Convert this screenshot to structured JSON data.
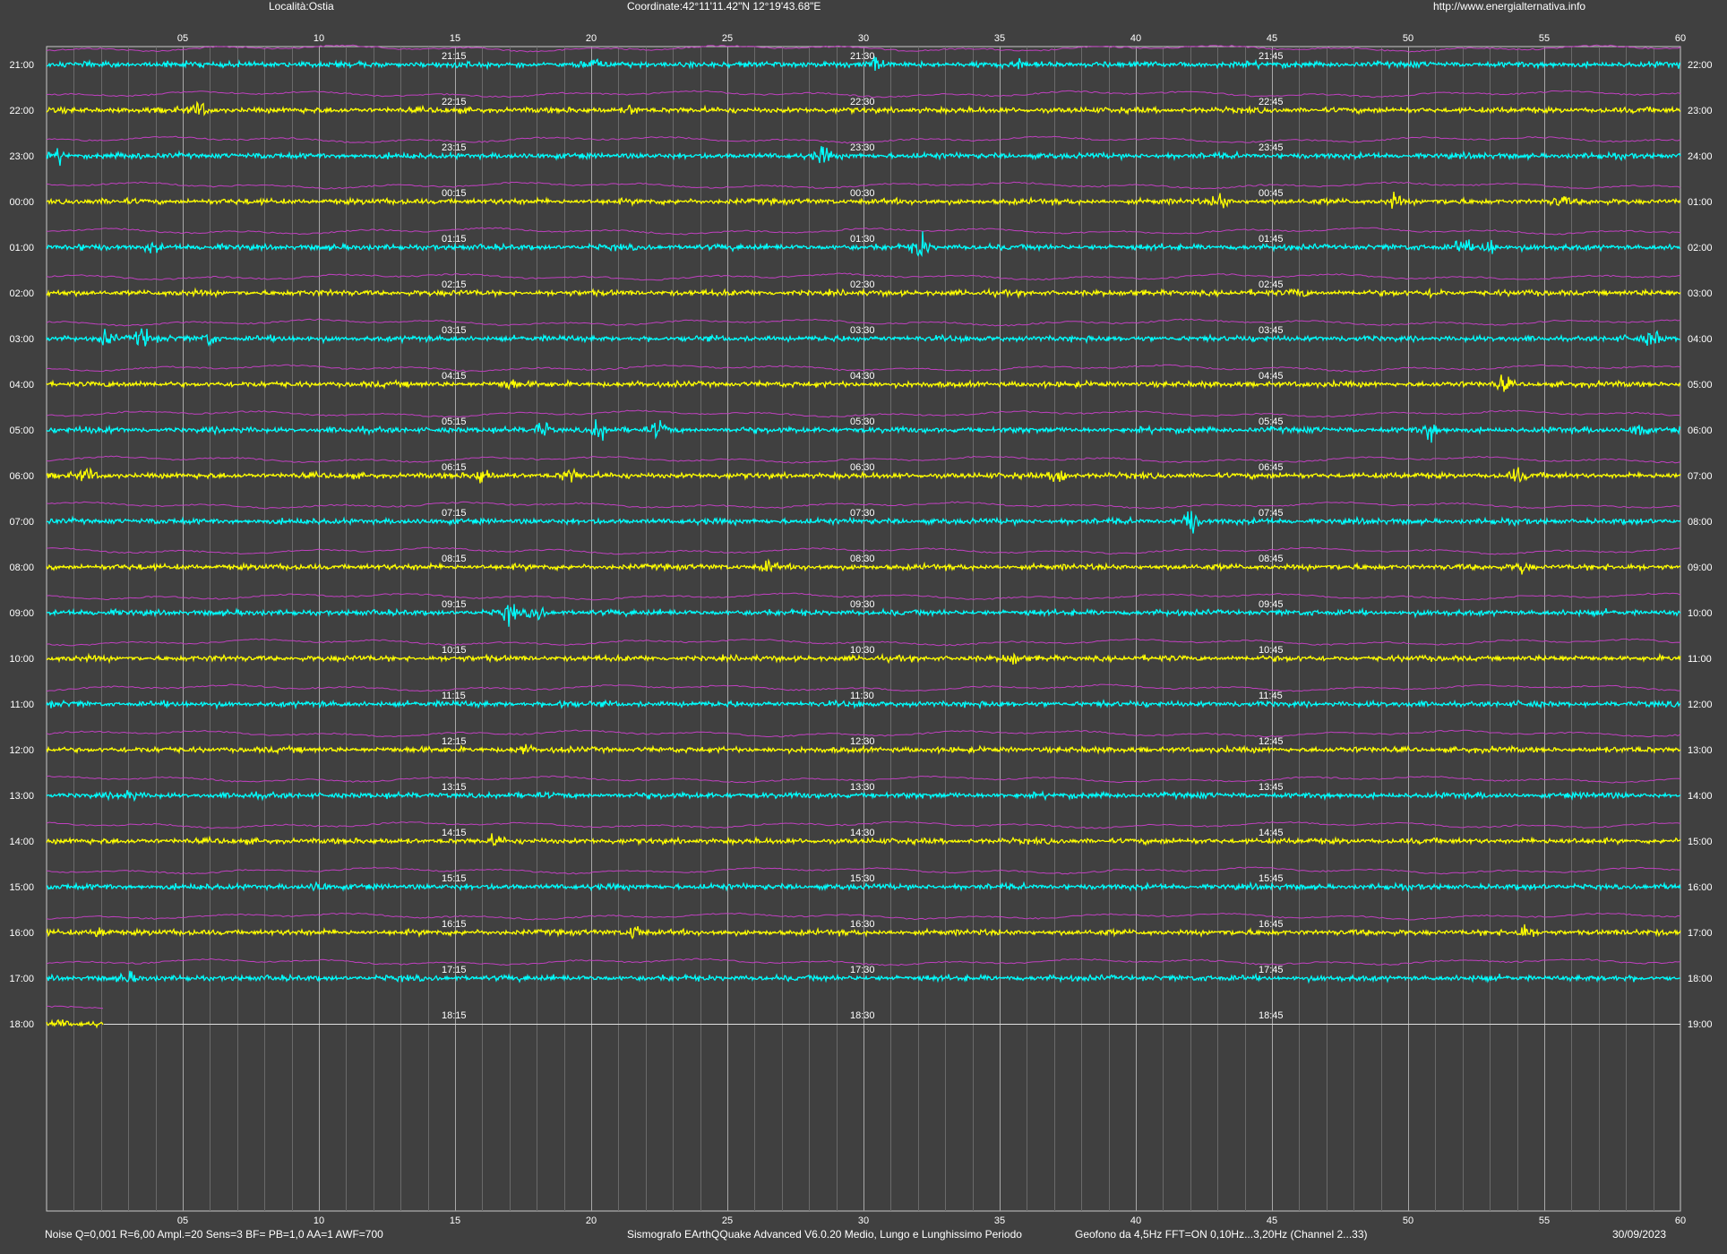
{
  "header": {
    "location": "Località:Ostia",
    "coordinates": "Coordinate:42°11'11.42\"N  12°19'43.68\"E",
    "website": "http://www.energialternativa.info"
  },
  "footer": {
    "settings": "Noise Q=0,001 R=6,00 Ampl.=20 Sens=3 BF= PB=1,0 AA=1 AWF=700",
    "software": "Sismografo  EArthQQuake Advanced V6.0.20  Medio, Lungo e Lunghissimo Periodo",
    "sensor": "Geofono da 4,5Hz FFT=ON 0,10Hz...3,20Hz      (Channel 2...33)",
    "date": "30/09/2023"
  },
  "colors": {
    "background": "#404040",
    "trace_a": "#00ffff",
    "trace_b": "#ffff00",
    "secondary_trace": "#c040c0",
    "grid": "#9a9a9a",
    "text": "#ffffff"
  },
  "chart_data": {
    "type": "line",
    "subtype": "helicorder",
    "x_ticks": [
      "05",
      "10",
      "15",
      "20",
      "25",
      "30",
      "35",
      "40",
      "45",
      "50",
      "55",
      "60"
    ],
    "x_range_minutes": [
      0,
      60
    ],
    "minor_tick_interval_minutes": 1,
    "row_labels_left": [
      "21:00",
      "22:00",
      "23:00",
      "00:00",
      "01:00",
      "02:00",
      "03:00",
      "04:00",
      "05:00",
      "06:00",
      "07:00",
      "08:00",
      "09:00",
      "10:00",
      "11:00",
      "12:00",
      "13:00",
      "14:00",
      "15:00",
      "16:00",
      "17:00",
      "18:00"
    ],
    "row_labels_right": [
      "22:00",
      "23:00",
      "24:00",
      "01:00",
      "02:00",
      "03:00",
      "04:00",
      "05:00",
      "06:00",
      "07:00",
      "08:00",
      "09:00",
      "10:00",
      "11:00",
      "12:00",
      "13:00",
      "14:00",
      "15:00",
      "16:00",
      "17:00",
      "18:00",
      "19:00"
    ],
    "quarter_labels": [
      [
        "21:15",
        "21:30",
        "21:45"
      ],
      [
        "22:15",
        "22:30",
        "22:45"
      ],
      [
        "23:15",
        "23:30",
        "23:45"
      ],
      [
        "00:15",
        "00:30",
        "00:45"
      ],
      [
        "01:15",
        "01:30",
        "01:45"
      ],
      [
        "02:15",
        "02:30",
        "02:45"
      ],
      [
        "03:15",
        "03:30",
        "03:45"
      ],
      [
        "04:15",
        "04:30",
        "04:45"
      ],
      [
        "05:15",
        "05:30",
        "05:45"
      ],
      [
        "06:15",
        "06:30",
        "06:45"
      ],
      [
        "07:15",
        "07:30",
        "07:45"
      ],
      [
        "08:15",
        "08:30",
        "08:45"
      ],
      [
        "09:15",
        "09:30",
        "09:45"
      ],
      [
        "10:15",
        "10:30",
        "10:45"
      ],
      [
        "11:15",
        "11:30",
        "11:45"
      ],
      [
        "12:15",
        "12:30",
        "12:45"
      ],
      [
        "13:15",
        "13:30",
        "13:45"
      ],
      [
        "14:15",
        "14:30",
        "14:45"
      ],
      [
        "15:15",
        "15:30",
        "15:45"
      ],
      [
        "16:15",
        "16:30",
        "16:45"
      ],
      [
        "17:15",
        "17:30",
        "17:45"
      ],
      [
        "18:15",
        "18:30",
        "18:45"
      ]
    ],
    "trace_colors_alternating": [
      "#00ffff",
      "#ffff00"
    ],
    "last_row_recorded_minutes": 2.1,
    "events": [
      {
        "row": 0,
        "minute": 20.0,
        "amp": 9
      },
      {
        "row": 0,
        "minute": 30.5,
        "amp": 6
      },
      {
        "row": 0,
        "minute": 35.8,
        "amp": 5
      },
      {
        "row": 1,
        "minute": 5.6,
        "amp": 8
      },
      {
        "row": 1,
        "minute": 21.5,
        "amp": 5
      },
      {
        "row": 2,
        "minute": 0.5,
        "amp": 6
      },
      {
        "row": 2,
        "minute": 28.5,
        "amp": 9
      },
      {
        "row": 3,
        "minute": 43.1,
        "amp": 9
      },
      {
        "row": 3,
        "minute": 49.5,
        "amp": 7
      },
      {
        "row": 3,
        "minute": 55.6,
        "amp": 6
      },
      {
        "row": 4,
        "minute": 3.9,
        "amp": 6
      },
      {
        "row": 4,
        "minute": 32.1,
        "amp": 14
      },
      {
        "row": 4,
        "minute": 52.0,
        "amp": 9
      },
      {
        "row": 4,
        "minute": 53.0,
        "amp": 10
      },
      {
        "row": 5,
        "minute": 46.0,
        "amp": 5
      },
      {
        "row": 5,
        "minute": 51.0,
        "amp": 5
      },
      {
        "row": 6,
        "minute": 2.2,
        "amp": 9
      },
      {
        "row": 6,
        "minute": 3.5,
        "amp": 12
      },
      {
        "row": 6,
        "minute": 6.0,
        "amp": 8
      },
      {
        "row": 6,
        "minute": 59.0,
        "amp": 9
      },
      {
        "row": 7,
        "minute": 17.0,
        "amp": 6
      },
      {
        "row": 7,
        "minute": 53.5,
        "amp": 8
      },
      {
        "row": 8,
        "minute": 18.2,
        "amp": 10
      },
      {
        "row": 8,
        "minute": 20.3,
        "amp": 12
      },
      {
        "row": 8,
        "minute": 22.5,
        "amp": 8
      },
      {
        "row": 8,
        "minute": 50.8,
        "amp": 11
      },
      {
        "row": 8,
        "minute": 58.5,
        "amp": 11
      },
      {
        "row": 9,
        "minute": 1.5,
        "amp": 7
      },
      {
        "row": 9,
        "minute": 16.0,
        "amp": 10
      },
      {
        "row": 9,
        "minute": 19.2,
        "amp": 9
      },
      {
        "row": 9,
        "minute": 37.2,
        "amp": 12
      },
      {
        "row": 9,
        "minute": 54.0,
        "amp": 7
      },
      {
        "row": 10,
        "minute": 42.0,
        "amp": 14
      },
      {
        "row": 11,
        "minute": 26.5,
        "amp": 6
      },
      {
        "row": 11,
        "minute": 54.2,
        "amp": 6
      },
      {
        "row": 12,
        "minute": 17.0,
        "amp": 9
      },
      {
        "row": 12,
        "minute": 18.0,
        "amp": 8
      },
      {
        "row": 13,
        "minute": 35.5,
        "amp": 7
      },
      {
        "row": 14,
        "minute": 19.0,
        "amp": 6
      },
      {
        "row": 15,
        "minute": 17.5,
        "amp": 5
      },
      {
        "row": 16,
        "minute": 3.0,
        "amp": 5
      },
      {
        "row": 17,
        "minute": 16.5,
        "amp": 6
      },
      {
        "row": 18,
        "minute": 10.0,
        "amp": 5
      },
      {
        "row": 19,
        "minute": 2.0,
        "amp": 6
      },
      {
        "row": 19,
        "minute": 21.6,
        "amp": 8
      },
      {
        "row": 19,
        "minute": 54.3,
        "amp": 8
      },
      {
        "row": 20,
        "minute": 3.0,
        "amp": 5
      },
      {
        "row": 21,
        "minute": 0.5,
        "amp": 3
      }
    ]
  }
}
